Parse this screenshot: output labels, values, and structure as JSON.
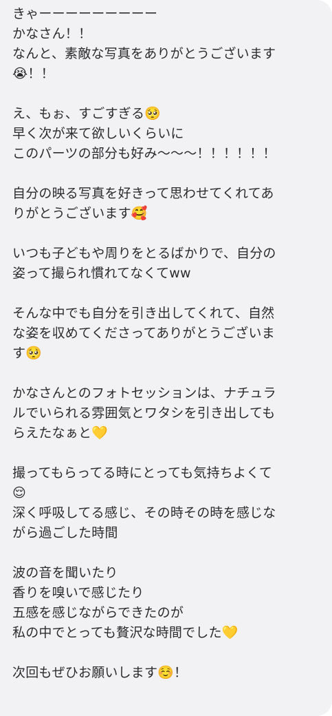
{
  "message": {
    "paragraphs": [
      {
        "lines": [
          "きゃーーーーーーーーー",
          "かなさん！！",
          "なんと、素敵な写真をありがとうございます",
          "😭！！"
        ]
      },
      {
        "lines": [
          "え、もぉ、すごすぎる🥺",
          "早く次が来て欲しいくらいに",
          "このパーツの部分も好み〜〜〜！！！！！！"
        ]
      },
      {
        "lines": [
          "自分の映る写真を好きって思わせてくれてあ",
          "りがとうございます🥰"
        ]
      },
      {
        "lines": [
          "いつも子どもや周りをとるばかりで、自分の",
          "姿って撮られ慣れてなくてww"
        ]
      },
      {
        "lines": [
          "そんな中でも自分を引き出してくれて、自然",
          "な姿を収めてくださってありがとうございま",
          "す🥺"
        ]
      },
      {
        "lines": [
          "かなさんとのフォトセッションは、ナチュラ",
          "ルでいられる雰囲気とワタシを引き出しても",
          "らえたなぁと💛"
        ]
      },
      {
        "lines": [
          "撮ってもらってる時にとっても気持ちよくて",
          "😌",
          "深く呼吸してる感じ、その時その時を感じな",
          "がら過ごした時間"
        ]
      },
      {
        "lines": [
          "波の音を聞いたり",
          "香りを嗅いで感じたり",
          "五感を感じながらできたのが",
          "私の中でとっても贅沢な時間でした💛"
        ]
      },
      {
        "lines": [
          "次回もぜひお願いします☺️！"
        ]
      }
    ]
  }
}
